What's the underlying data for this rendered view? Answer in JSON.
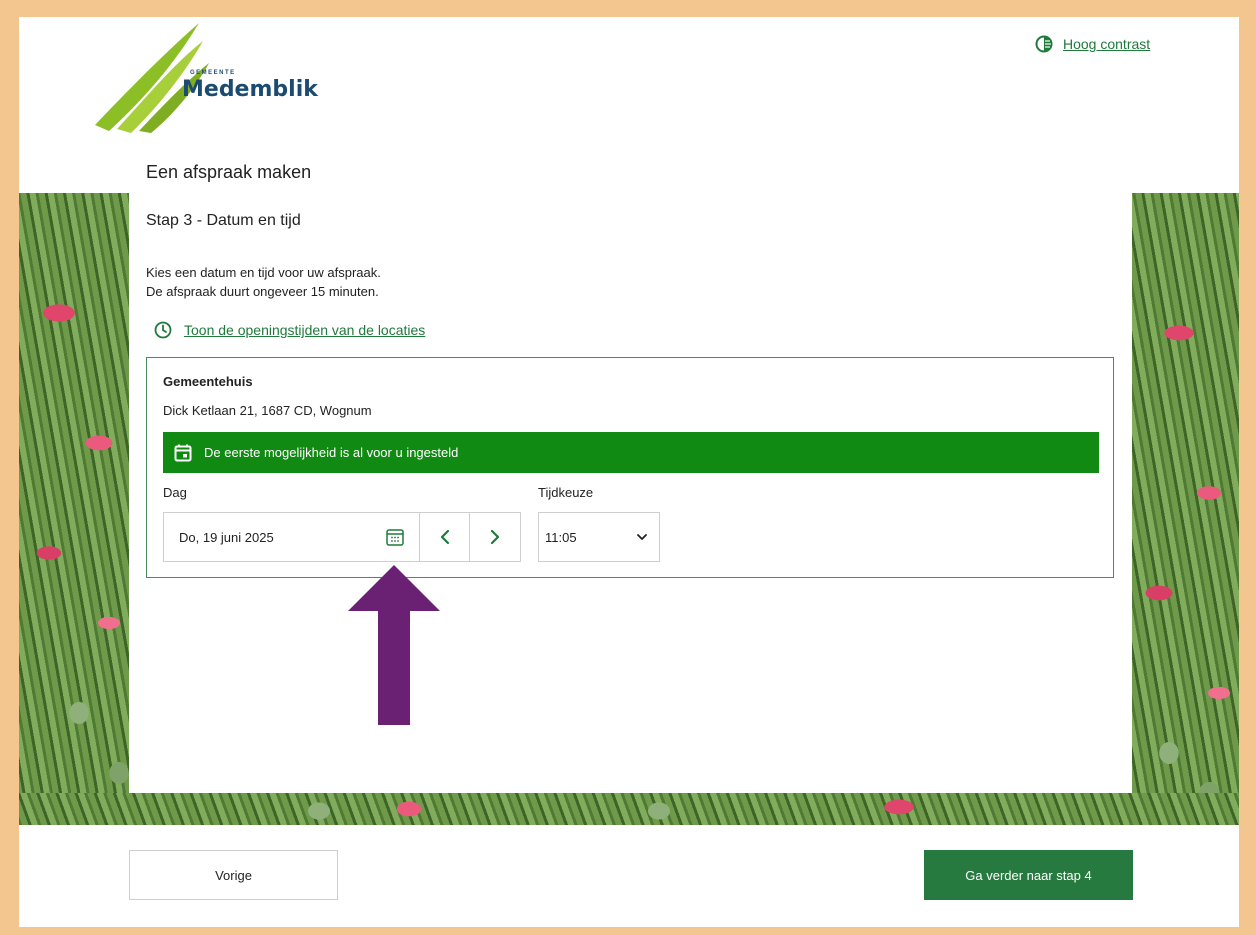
{
  "header": {
    "logo_small": "GEMEENTE",
    "logo_name": "Medemblik",
    "contrast_label": "Hoog contrast"
  },
  "page": {
    "title": "Een afspraak maken",
    "step": "Stap 3 - Datum en tijd",
    "intro_line1": "Kies een datum en tijd voor uw afspraak.",
    "intro_line2": "De afspraak duurt ongeveer 15 minuten.",
    "hours_link": "Toon de openingstijden van de locaties"
  },
  "location": {
    "name": "Gemeentehuis",
    "address": "Dick Ketlaan 21, 1687 CD, Wognum",
    "banner": "De eerste mogelijkheid is al voor u ingesteld",
    "day_label": "Dag",
    "time_label": "Tijdkeuze",
    "date_value": "Do, 19 juni 2025",
    "time_value": "11:05"
  },
  "footer": {
    "prev_label": "Vorige",
    "next_label": "Ga verder naar stap 4"
  },
  "colors": {
    "accent": "#1f7a3c",
    "banner": "#118a13",
    "next_button": "#277a3f",
    "arrow": "#6a2174",
    "border": "#f3c58f"
  }
}
